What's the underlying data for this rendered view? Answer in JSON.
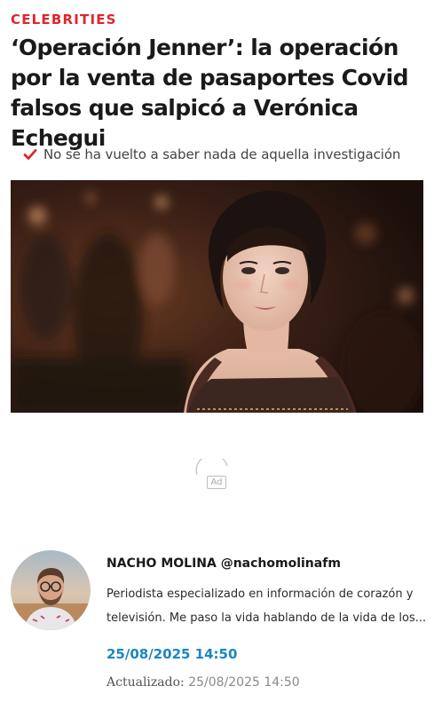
{
  "article": {
    "section": "CELEBRITIES",
    "headline": "‘Operación Jenner’: la operación por la venta de pasaportes Covid falsos que salpicó a Verónica Echegui",
    "subheadline": "No se ha vuelto a saber nada de aquella investigación",
    "image_subject": "portrait-of-actress"
  },
  "ad": {
    "label": "Ad"
  },
  "author": {
    "name": "NACHO MOLINA @nachomolinafm",
    "bio_line1": "Periodista especializado en información de corazón y",
    "bio_line2": "televisión. Me paso la vida hablando de la vida de los...",
    "published": "25/08/2025 14:50",
    "updated_label": "Actualizado: ",
    "updated_date": "25/08/2025 14:50"
  },
  "colors": {
    "accent_red": "#e0252b",
    "date_blue": "#1c86c4"
  }
}
